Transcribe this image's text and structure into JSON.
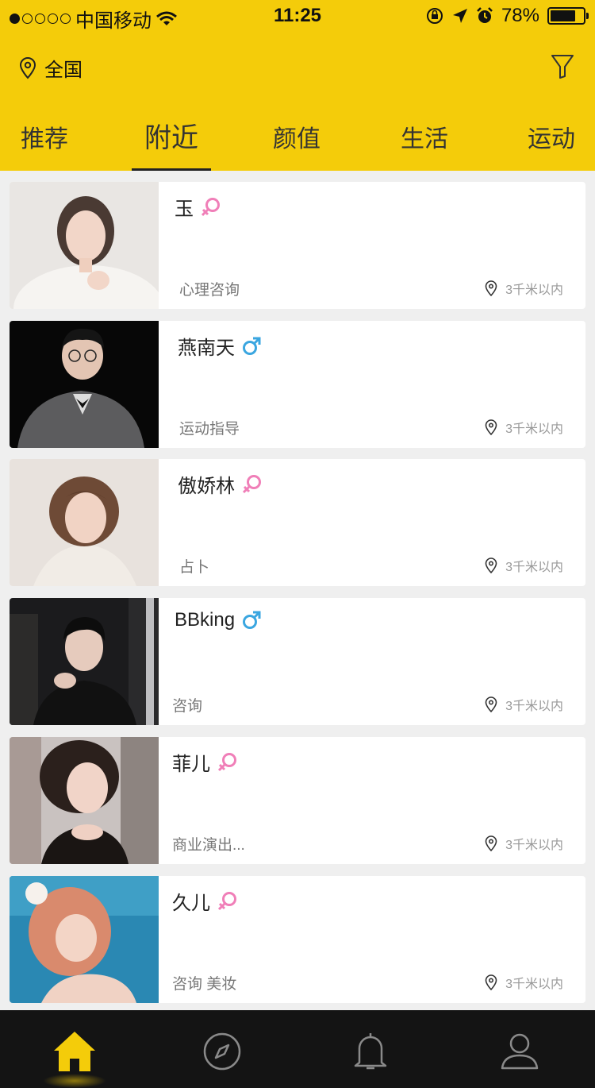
{
  "status_bar": {
    "carrier": "中国移动",
    "time": "11:25",
    "battery": "78%",
    "battery_level": 0.78
  },
  "header": {
    "location": "全国",
    "tabs": [
      "推荐",
      "附近",
      "颜值",
      "生活",
      "运动"
    ],
    "active_tab": "附近"
  },
  "list": [
    {
      "name": "玉",
      "gender": "female",
      "tag": "心理咨询",
      "distance": "3千米以内"
    },
    {
      "name": "燕南天",
      "gender": "male",
      "tag": "运动指导",
      "distance": "3千米以内"
    },
    {
      "name": "傲娇林",
      "gender": "female",
      "tag": "占卜",
      "distance": "3千米以内"
    },
    {
      "name": "BBking",
      "gender": "male",
      "tag": "咨询",
      "distance": "3千米以内"
    },
    {
      "name": "菲儿",
      "gender": "female",
      "tag": "商业演出...",
      "distance": "3千米以内"
    },
    {
      "name": "久儿",
      "gender": "female",
      "tag": "咨询 美妆",
      "distance": "3千米以内"
    }
  ],
  "tab_bar": [
    {
      "icon": "home-icon",
      "active": true
    },
    {
      "icon": "compass-icon",
      "active": false
    },
    {
      "icon": "bell-icon",
      "active": false
    },
    {
      "icon": "user-icon",
      "active": false
    }
  ],
  "colors": {
    "accent": "#f4cc0a",
    "female": "#f07fb8",
    "male": "#3aa6e0",
    "tabbar_bg": "#141414"
  }
}
